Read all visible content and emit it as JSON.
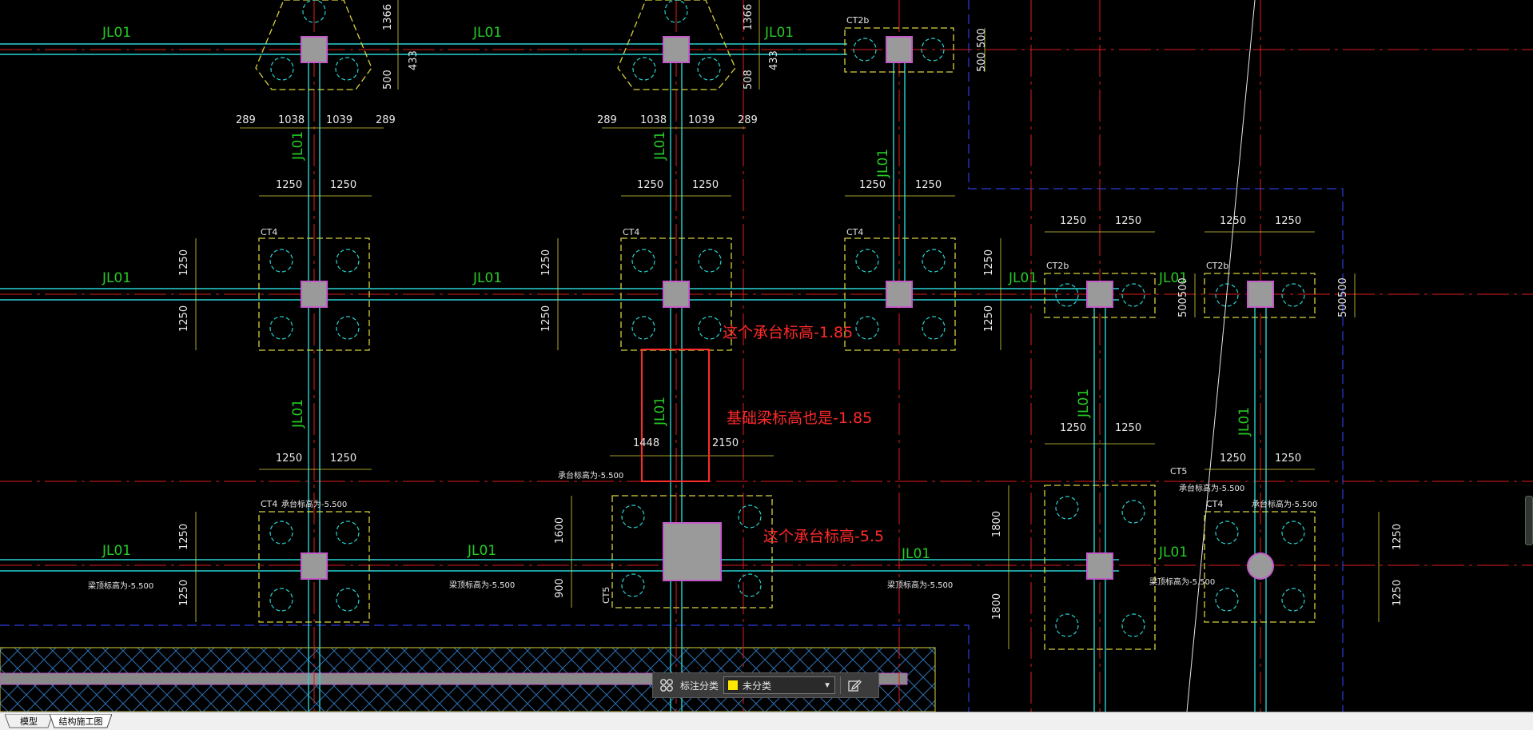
{
  "drawing": {
    "beam_label": "JL01",
    "pile_caps": {
      "ct4": "CT4",
      "ct2b": "CT2b",
      "ct5": "CT5"
    },
    "dimensions": {
      "d1366": "1366",
      "d433": "433",
      "d500": "500",
      "d508": "508",
      "d289": "289",
      "d1038": "1038",
      "d1039": "1039",
      "d1250": "1250",
      "d1448": "1448",
      "d2150": "2150",
      "d1600": "1600",
      "d900": "900",
      "d1800": "1800"
    },
    "elevation_notes": {
      "cap_elev": "承台标高为-5.500",
      "beam_elev": "梁顶标高为-5.500"
    },
    "annotations": {
      "note_cap_185": "这个承台标高-1.85",
      "note_beam_185": "基础梁标高也是-1.85",
      "note_cap_55": "这个承台标高-5.5"
    },
    "colors": {
      "grid_red": "#e01b1b",
      "beam_cyan": "#29d3d3",
      "cap_yellow": "#d9d13a",
      "pile_magenta": "#c35ac8",
      "label_green": "#25cc25",
      "annotation_red": "#ff2a2a",
      "boundary_blue": "#2a3cdc"
    }
  },
  "toolbar": {
    "grid_icon": "grid-icon",
    "category_label": "标注分类",
    "category_value": "未分类",
    "edit_icon": "edit-icon"
  },
  "tabs": {
    "model": "模型",
    "layout": "结构施工图"
  }
}
